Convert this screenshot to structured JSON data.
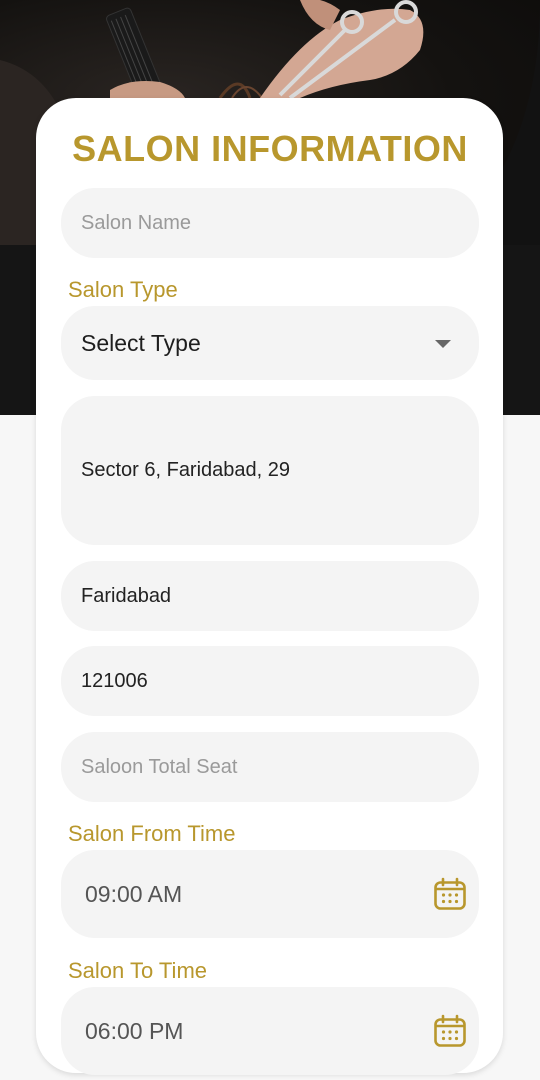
{
  "header": {
    "title": "SALON INFORMATION"
  },
  "form": {
    "salon_name": {
      "placeholder": "Salon Name",
      "value": ""
    },
    "salon_type": {
      "label": "Salon Type",
      "selected": "Select Type"
    },
    "address": {
      "value": "Sector 6, Faridabad, 29"
    },
    "city": {
      "value": "Faridabad"
    },
    "pincode": {
      "value": "121006"
    },
    "total_seat": {
      "placeholder": "Saloon Total Seat",
      "value": ""
    },
    "from_time": {
      "label": "Salon From Time",
      "value": "09:00 AM",
      "icon": "calendar-icon"
    },
    "to_time": {
      "label": "Salon To Time",
      "value": "06:00 PM",
      "icon": "calendar-icon"
    }
  },
  "colors": {
    "accent": "#b8972d",
    "field_bg": "#f4f4f4",
    "hero_bg": "#121212"
  }
}
